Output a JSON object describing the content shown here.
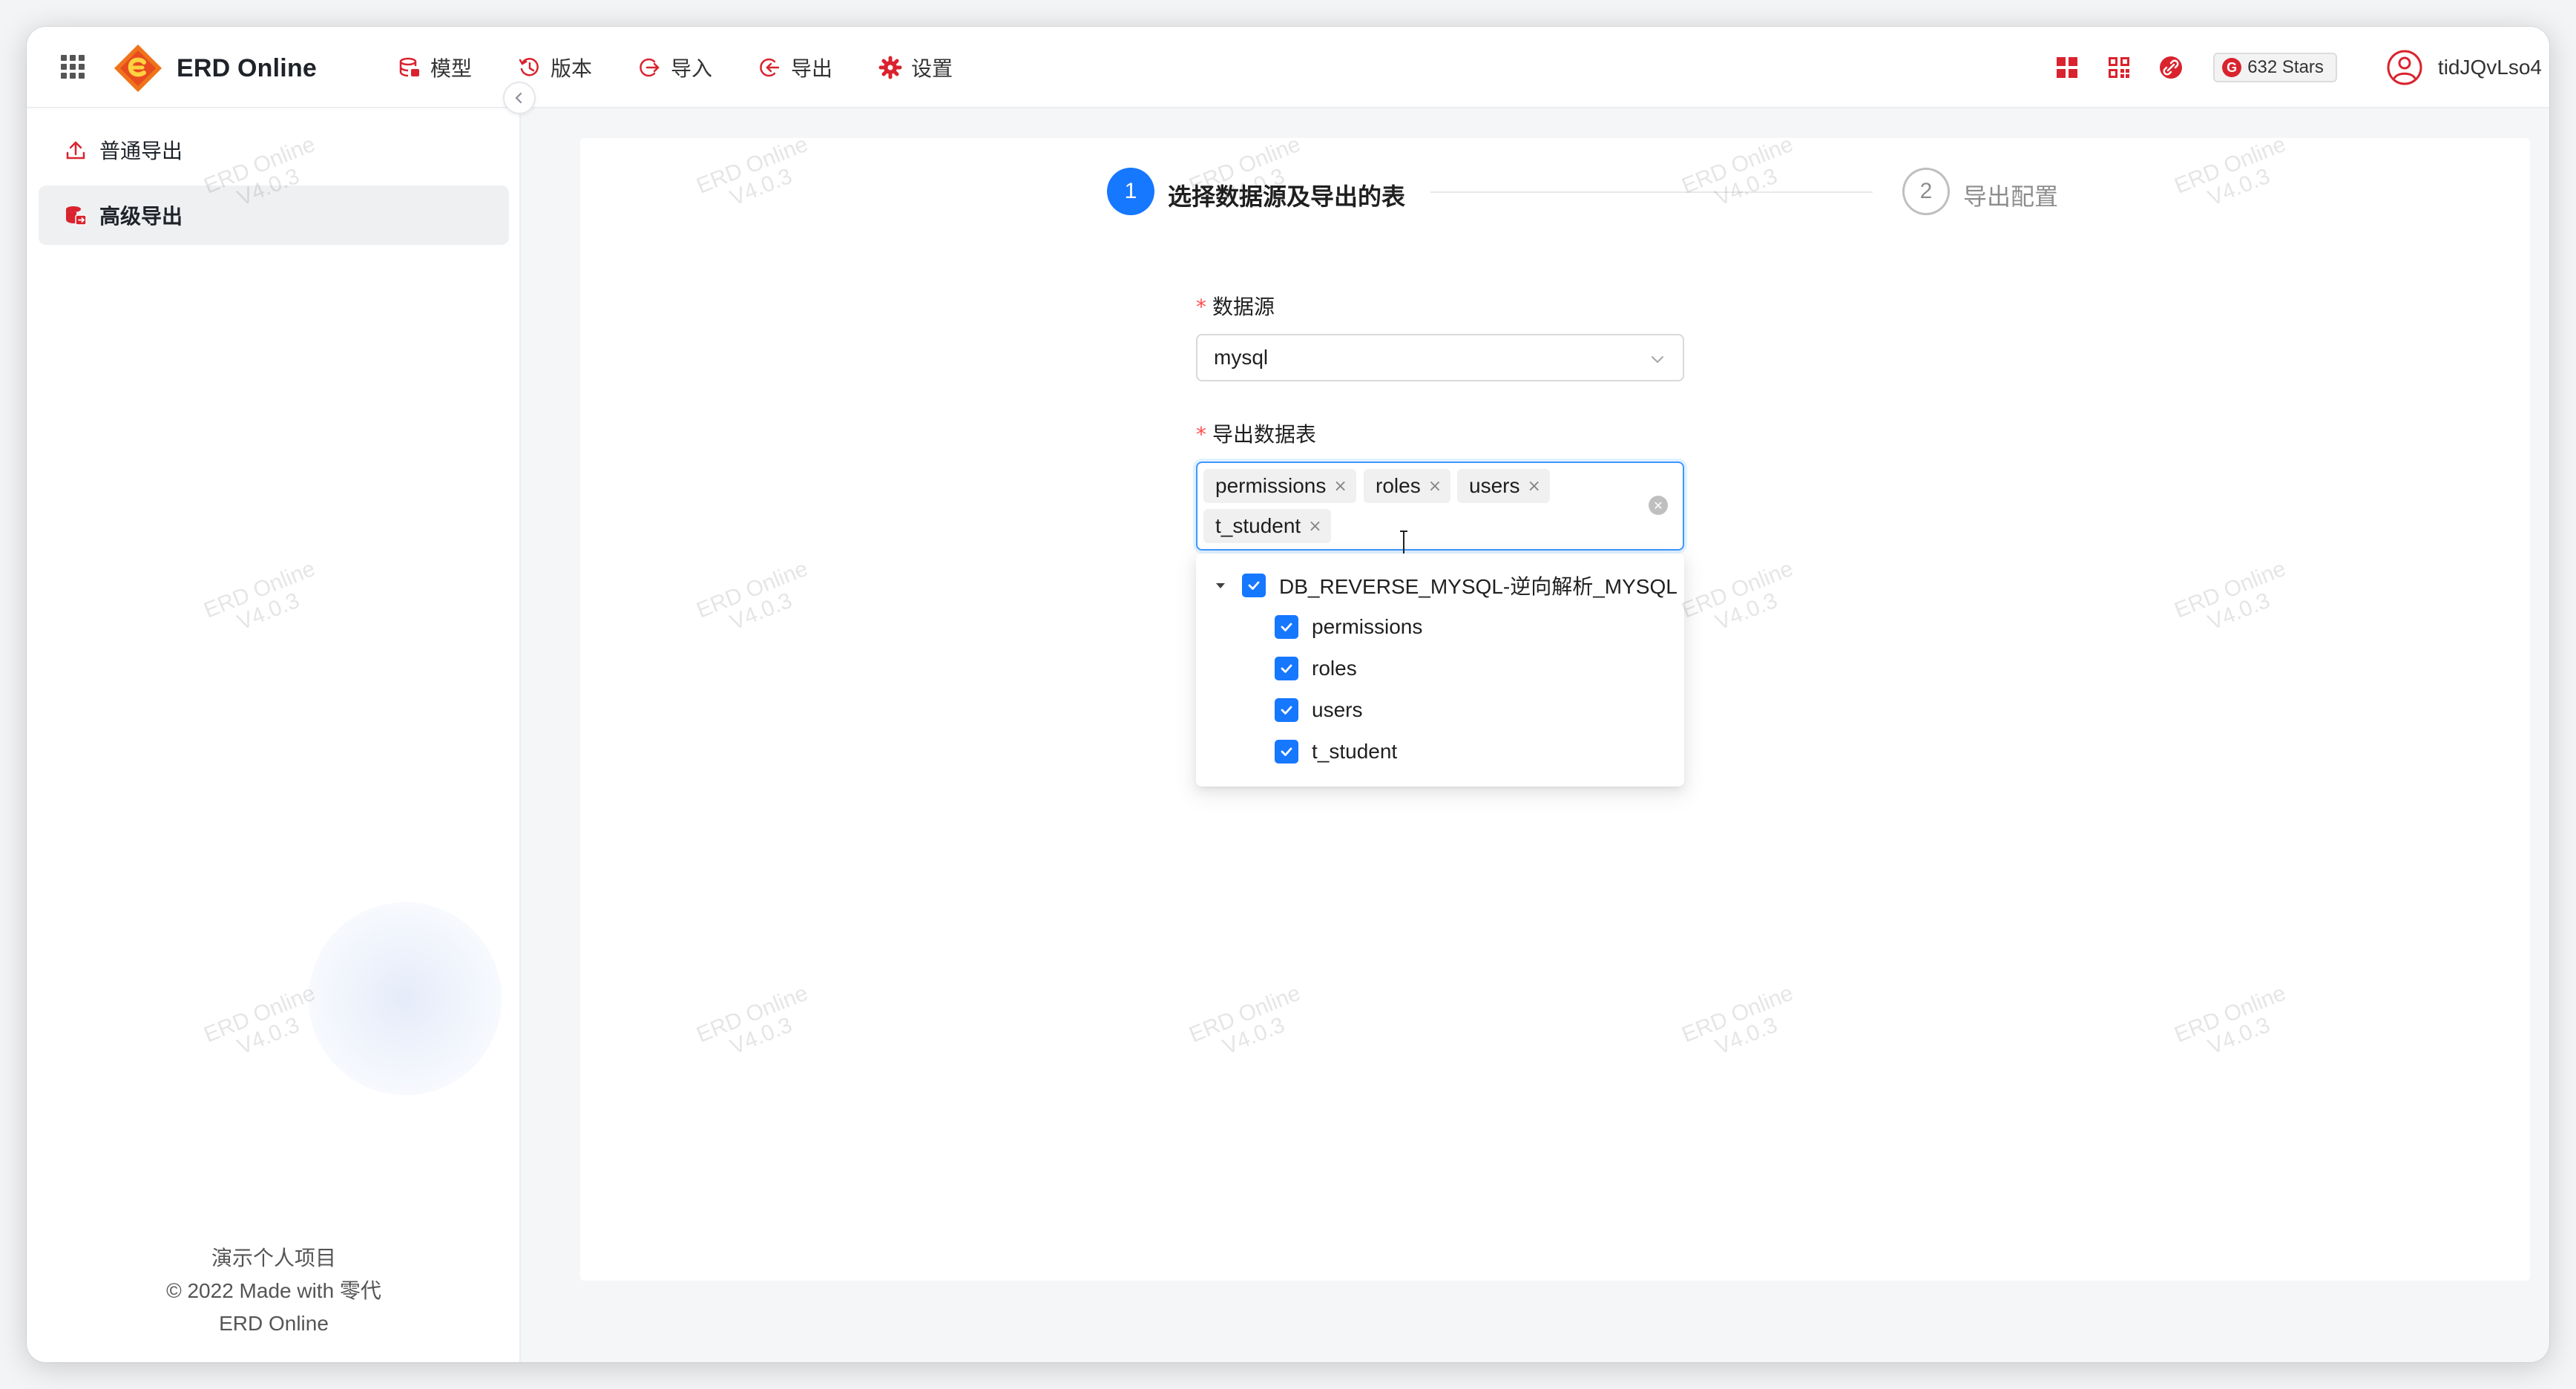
{
  "app": {
    "name": "ERD Online"
  },
  "nav": [
    {
      "label": "模型",
      "icon": "database-icon"
    },
    {
      "label": "版本",
      "icon": "history-icon"
    },
    {
      "label": "导入",
      "icon": "import-icon"
    },
    {
      "label": "导出",
      "icon": "export-icon"
    },
    {
      "label": "设置",
      "icon": "gear-icon"
    }
  ],
  "header_right": {
    "stars": "632 Stars",
    "stars_badge_letter": "G",
    "username": "tidJQvLso4"
  },
  "sidebar": {
    "items": [
      {
        "label": "普通导出",
        "icon": "upload-icon",
        "active": false
      },
      {
        "label": "高级导出",
        "icon": "database-export-icon",
        "active": true
      }
    ],
    "footer": [
      "演示个人项目",
      "© 2022 Made with 零代",
      "ERD Online"
    ]
  },
  "steps": [
    {
      "number": "1",
      "title": "选择数据源及导出的表",
      "active": true
    },
    {
      "number": "2",
      "title": "导出配置",
      "active": false
    }
  ],
  "form": {
    "datasource_label": "数据源",
    "datasource_value": "mysql",
    "tables_label": "导出数据表",
    "required_mark": "*",
    "tags": [
      {
        "label": "permissions"
      },
      {
        "label": "roles"
      },
      {
        "label": "users"
      },
      {
        "label": "t_student"
      }
    ],
    "tag_remove": "×"
  },
  "tree": {
    "root": {
      "label": "DB_REVERSE_MYSQL-逆向解析_MYSQL",
      "checked": true,
      "expanded": true
    },
    "children": [
      {
        "label": "permissions",
        "checked": true
      },
      {
        "label": "roles",
        "checked": true
      },
      {
        "label": "users",
        "checked": true
      },
      {
        "label": "t_student",
        "checked": true
      }
    ]
  },
  "watermark": {
    "line1": "ERD Online",
    "line2": "V4.0.3"
  },
  "colors": {
    "primary": "#1677ff",
    "brand_red": "#d9232e",
    "logo_orange": "#f0731a"
  }
}
